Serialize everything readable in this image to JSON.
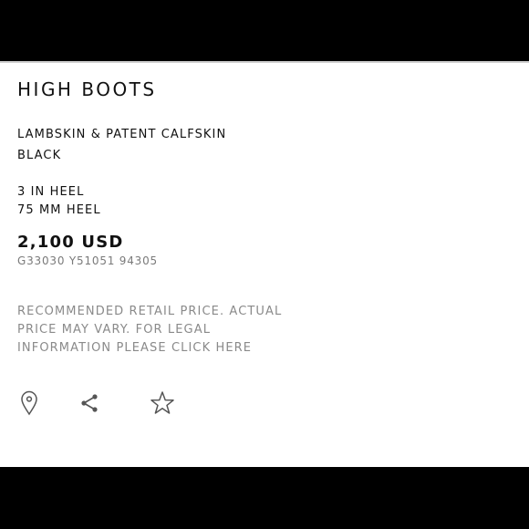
{
  "product": {
    "title": "HIGH BOOTS",
    "material": "LAMBSKIN & PATENT CALFSKIN",
    "color": "BLACK",
    "heel_in": "3 IN HEEL",
    "heel_mm": "75 MM HEEL",
    "price": "2,100 USD",
    "sku": "G33030 Y51051 94305"
  },
  "disclaimer": {
    "line1": "RECOMMENDED RETAIL PRICE. ACTUAL",
    "line2": "PRICE MAY VARY. FOR LEGAL",
    "line3": "INFORMATION PLEASE CLICK HERE"
  },
  "actions": {
    "icons": [
      "location-pin-icon",
      "share-icon",
      "star-icon"
    ]
  },
  "colors": {
    "bars": "#000000",
    "text": "#111111",
    "muted": "#8a8a8a"
  }
}
